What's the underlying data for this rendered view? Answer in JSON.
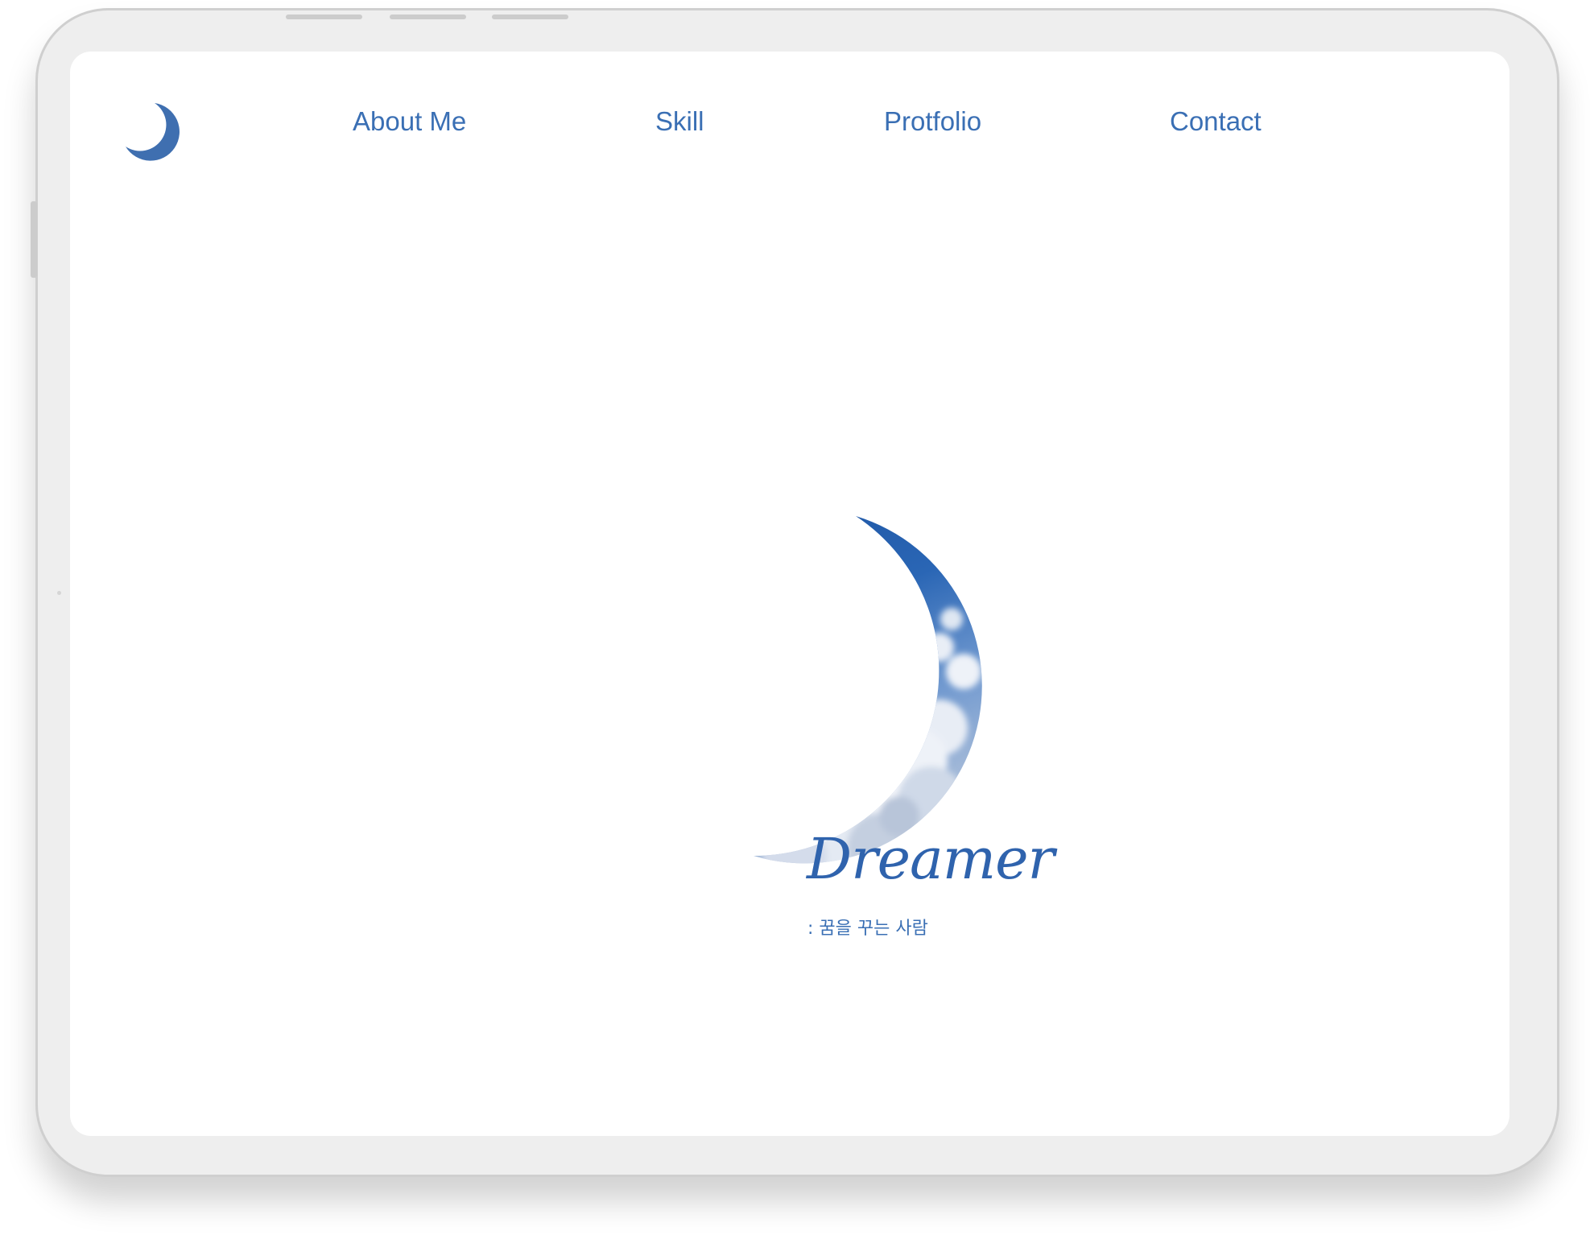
{
  "nav": {
    "items": [
      {
        "label": "About Me"
      },
      {
        "label": "Skill"
      },
      {
        "label": "Protfolio"
      },
      {
        "label": "Contact"
      }
    ]
  },
  "logo": {
    "icon": "crescent-moon-icon",
    "color": "#3f6fb0"
  },
  "hero": {
    "image": "crescent-moon-sky-image",
    "title": "Dreamer",
    "subtitle": ": 꿈을 꾸는 사람"
  },
  "colors": {
    "accent": "#3a6fb4",
    "device_frame": "#eeeeee",
    "background": "#ffffff"
  }
}
